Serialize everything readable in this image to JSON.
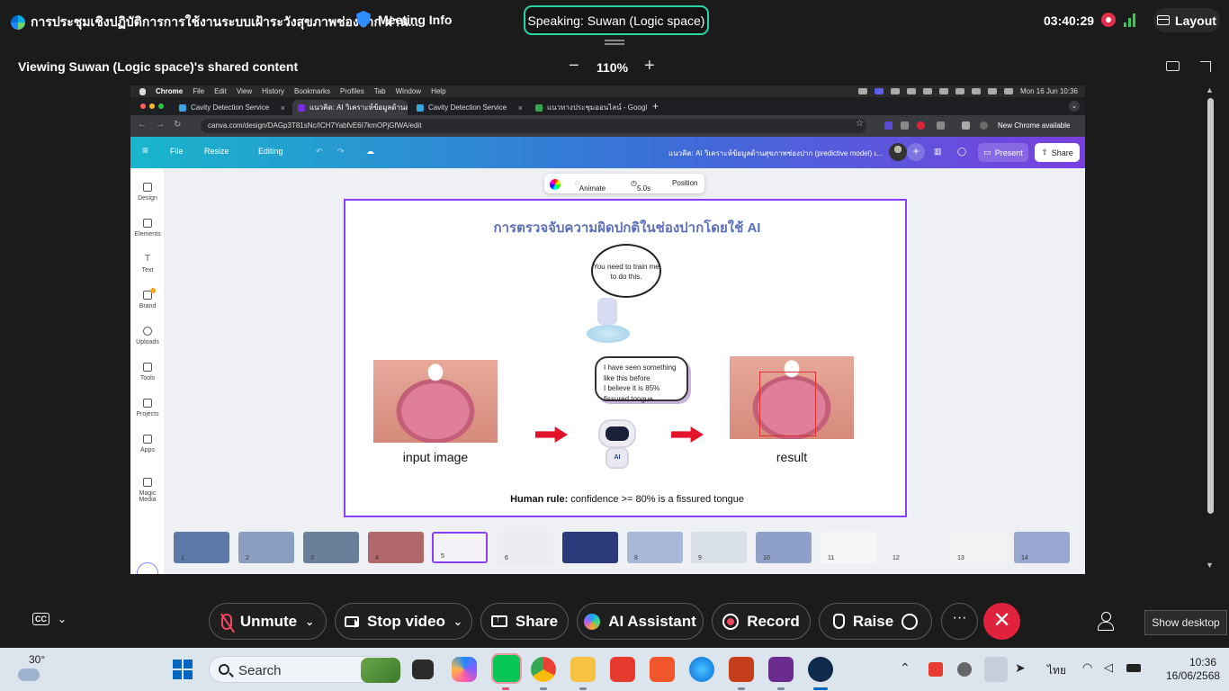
{
  "topbar": {
    "meeting_title": "การประชุมเชิงปฏิบัติการการใช้งานระบบเฝ้าระวังสุขภาพช่องปาก ผ่าน...",
    "meeting_info": "Meeting Info",
    "speaking": "Speaking: Suwan (Logic space)",
    "time": "03:40:29",
    "layout": "Layout"
  },
  "viewbar": {
    "viewing": "Viewing Suwan (Logic space)'s shared content",
    "zoom": "110%",
    "zoom_out": "−",
    "zoom_in": "+"
  },
  "shared": {
    "mac_menu": {
      "app": "Chrome",
      "items": [
        "File",
        "Edit",
        "View",
        "History",
        "Bookmarks",
        "Profiles",
        "Tab",
        "Window",
        "Help"
      ],
      "datetime": "Mon 16 Jun 10:36"
    },
    "tabs": [
      {
        "label": "Cavity Detection Service",
        "active": false
      },
      {
        "label": "แนวคิด: AI วิเคราะห์ข้อมูลด้านสุข...",
        "active": true
      },
      {
        "label": "Cavity Detection Service",
        "active": false
      },
      {
        "label": "แนวทางประชุมออนไลน์ - Google ...",
        "active": false
      }
    ],
    "url": "canva.com/design/DAGp3T81sNc/ICH7YabfvE6I7kmOPjGfWA/edit",
    "new_chrome": "New Chrome available",
    "canva": {
      "file": "File",
      "resize": "Resize",
      "editing": "Editing",
      "doc_title": "แนวคิด: AI วิเคราะห์ข้อมูลด้านสุขภาพช่องปาก (predictive model) เ...",
      "present": "Present",
      "share": "Share",
      "sidebar": [
        "Design",
        "Elements",
        "Text",
        "Brand",
        "Uploads",
        "Tools",
        "Projects",
        "Apps",
        "Magic Media"
      ],
      "element_toolbar": {
        "animate": "Animate",
        "duration": "5.0s",
        "position": "Position"
      }
    },
    "slide": {
      "title": "การตรวจจับความผิดปกติในช่องปากโดยใช้ AI",
      "bubble_top": "You need to train me to do this.",
      "bubble_mid": [
        "I have seen something",
        "like this before",
        "I believe it is 85%",
        "fissured tongue"
      ],
      "robot_badge": "AI",
      "caption_left": "input image",
      "caption_right": "result",
      "rule_bold": "Human rule:",
      "rule_text": " confidence >= 80% is a fissured tongue"
    },
    "thumbnails": [
      {
        "num": "1",
        "color": "#5c7aa8"
      },
      {
        "num": "2",
        "color": "#8a9ec0"
      },
      {
        "num": "3",
        "color": "#6a7f9a"
      },
      {
        "num": "4",
        "color": "#b0686a"
      },
      {
        "num": "5",
        "color": "#f4f4f8",
        "selected": true
      },
      {
        "num": "6",
        "color": "#ececf0"
      },
      {
        "num": "7",
        "color": "#2b3a7a"
      },
      {
        "num": "8",
        "color": "#a8b8d8"
      },
      {
        "num": "9",
        "color": "#d8dfe8"
      },
      {
        "num": "10",
        "color": "#8ea0c8"
      },
      {
        "num": "11",
        "color": "#f6f6f6"
      },
      {
        "num": "12",
        "color": "#f0f0f4"
      },
      {
        "num": "13",
        "color": "#f2f2f2"
      },
      {
        "num": "14",
        "color": "#97a7cf"
      }
    ]
  },
  "controls": {
    "cc": "CC",
    "unmute": "Unmute",
    "stop_video": "Stop video",
    "share": "Share",
    "ai_assistant": "AI Assistant",
    "record": "Record",
    "raise": "Raise",
    "more": "···",
    "leave": "✕",
    "tooltip": "Show desktop"
  },
  "taskbar": {
    "temp": "30°",
    "search": "Search",
    "lang": "ไทย",
    "time": "10:36",
    "date": "16/06/2568"
  }
}
